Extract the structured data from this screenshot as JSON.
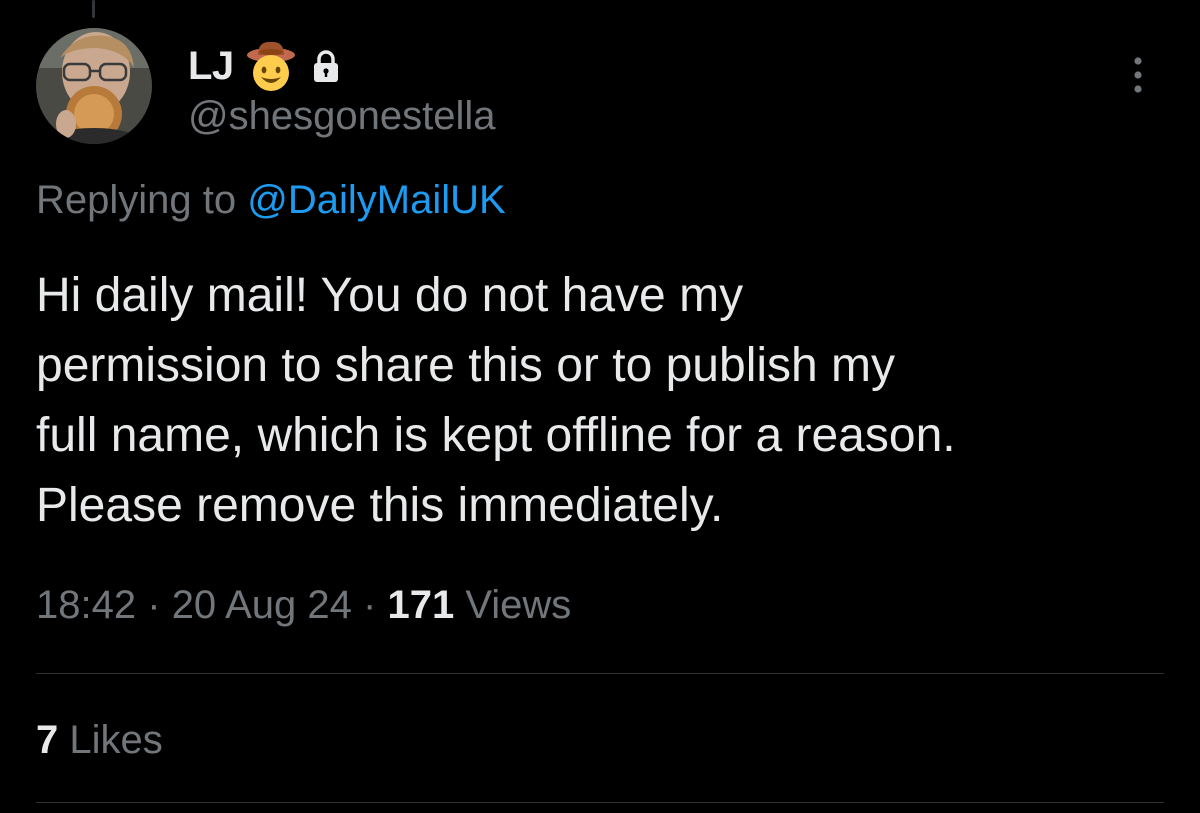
{
  "author": {
    "display_name": "LJ",
    "handle": "@shesgonestella",
    "badges": [
      "cowboy-hat-face-emoji",
      "lock-icon"
    ]
  },
  "reply": {
    "prefix": "Replying to",
    "mention": "@DailyMailUK"
  },
  "tweet": {
    "lines": [
      "Hi daily mail! You do not have my",
      "permission to share this or to publish my",
      "full name, which is kept offline for a reason.",
      "Please remove this immediately."
    ]
  },
  "meta": {
    "time": "18:42",
    "separator": "·",
    "date": "20 Aug 24",
    "views_count": "171",
    "views_label": "Views"
  },
  "engagement": {
    "likes_count": "7",
    "likes_label": "Likes"
  },
  "colors": {
    "background": "#000000",
    "text": "#e7e9ea",
    "secondary": "#71767b",
    "link": "#1d9bf0",
    "divider": "#2f3336"
  },
  "icons": {
    "more": "more-vertical-icon",
    "lock": "lock-icon",
    "emoji": "cowboy-hat-face-emoji"
  }
}
